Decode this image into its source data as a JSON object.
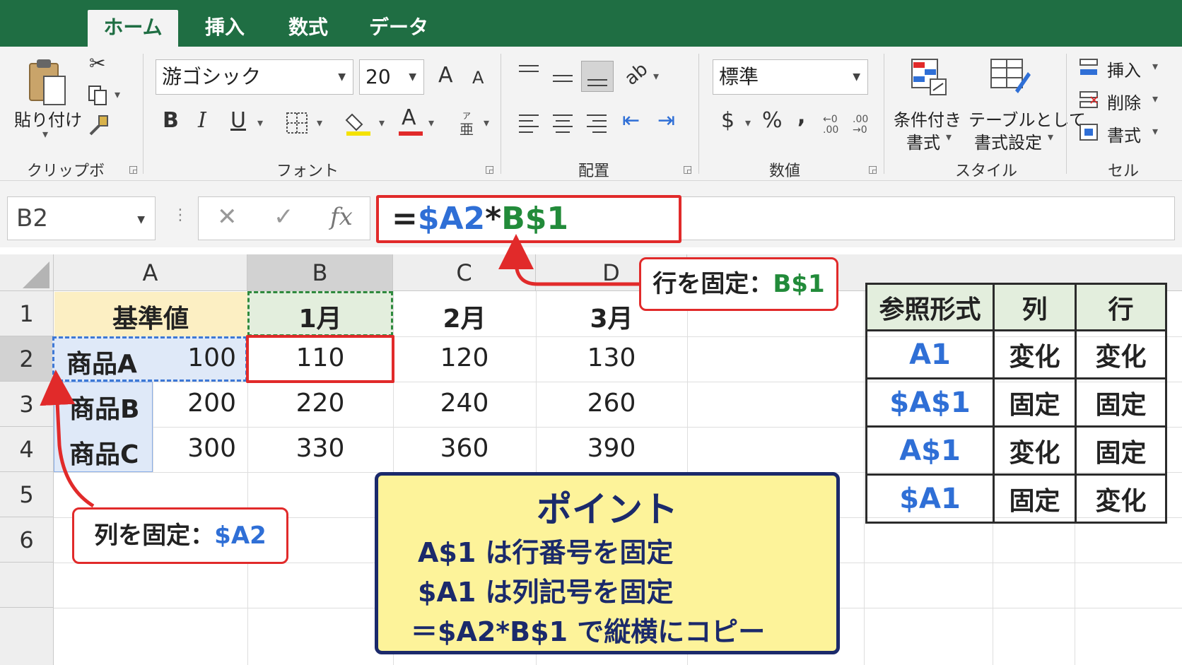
{
  "tabs": [
    "ホーム",
    "挿入",
    "数式",
    "データ"
  ],
  "clipboard": {
    "paste_label": "貼り付け",
    "group_label": "クリップボード"
  },
  "font": {
    "name": "游ゴシック",
    "size": "20",
    "grow_label": "A",
    "shrink_label": "A",
    "bold": "B",
    "italic": "I",
    "underline": "U",
    "color_letter": "A",
    "group_label": "フォント"
  },
  "alignment": {
    "group_label": "配置"
  },
  "number": {
    "format": "標準",
    "currency": "$",
    "percent": "%",
    "comma": ",",
    "inc_decimal": "←0\n.00",
    "dec_decimal": ".00\n→0",
    "group_label": "数値"
  },
  "styles": {
    "conditional_1": "条件付き",
    "conditional_2": "書式",
    "table_1": "テーブルとして",
    "table_2": "書式設定",
    "group_label": "スタイル"
  },
  "cells": {
    "insert": "挿入",
    "delete": "削除",
    "format": "書式",
    "group_label": "セル"
  },
  "formula_bar": {
    "name_box": "B2",
    "cancel": "✕",
    "enter": "✓",
    "fx": "fx",
    "formula_eq": "=",
    "formula_col_ref": "$A2",
    "formula_op": "*",
    "formula_row_ref": "B$1"
  },
  "sheet": {
    "columns": [
      "A",
      "B",
      "C",
      "D"
    ],
    "rows": [
      "1",
      "2",
      "3",
      "4",
      "5",
      "6"
    ],
    "a1": "基準値",
    "months": [
      "1月",
      "2月",
      "3月"
    ],
    "products": [
      "商品A",
      "商品B",
      "商品C"
    ],
    "base_values": [
      "100",
      "200",
      "300"
    ],
    "col_b": [
      "110",
      "220",
      "330"
    ],
    "col_c": [
      "120",
      "240",
      "360"
    ],
    "col_d": [
      "130",
      "260",
      "390"
    ]
  },
  "callouts": {
    "row_fixed_label": "行を固定：",
    "row_fixed_ref": "B$1",
    "col_fixed_label": "列を固定：",
    "col_fixed_ref": "$A2"
  },
  "point": {
    "title": "ポイント",
    "line1": "A$1 は行番号を固定",
    "line2": "$A1 は列記号を固定",
    "line3": "＝$A2*B$1 で縦横にコピー"
  },
  "ref_table": {
    "headers": [
      "参照形式",
      "列",
      "行"
    ],
    "rows": [
      [
        "A1",
        "変化",
        "変化"
      ],
      [
        "$A$1",
        "固定",
        "固定"
      ],
      [
        "A$1",
        "変化",
        "固定"
      ],
      [
        "$A1",
        "固定",
        "変化"
      ]
    ]
  },
  "colors": {
    "excel_green": "#1f6e43",
    "highlight_red": "#e12a2a",
    "ref_blue": "#2f6fd6",
    "ref_green": "#228b3a",
    "point_bg": "#fdf39a",
    "point_border": "#1b2a6b"
  }
}
